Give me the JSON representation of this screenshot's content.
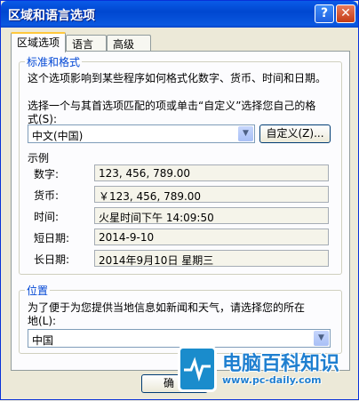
{
  "window": {
    "title": "区域和语言选项",
    "help_label": "?",
    "close_label": "✕"
  },
  "tabs": [
    {
      "label": "区域选项",
      "active": true
    },
    {
      "label": "语言",
      "active": false
    },
    {
      "label": "高级",
      "active": false
    }
  ],
  "standards": {
    "group_title": "标准和格式",
    "description": "这个选项影响到某些程序如何格式化数字、货币、时间和日期。",
    "select_prompt_line1": "选择一个与其首选项匹配的项或单击“自定义”选择您自己的格",
    "select_prompt_line2": "式(S):",
    "format_value": "中文(中国)",
    "customize_button": "自定义(Z)...",
    "samples_title": "示例",
    "samples": [
      {
        "label": "数字:",
        "value": "123, 456, 789.00"
      },
      {
        "label": "货币:",
        "value": "￥123, 456, 789.00"
      },
      {
        "label": "时间:",
        "value": "火星时间下午 14:09:50"
      },
      {
        "label": "短日期:",
        "value": "2014-9-10"
      },
      {
        "label": "长日期:",
        "value": "2014年9月10日 星期三"
      }
    ]
  },
  "location": {
    "group_title": "位置",
    "description_line1": "为了便于为您提供当地信息如新闻和天气，请选择您的所在",
    "description_line2": "地(L):",
    "value": "中国"
  },
  "footer": {
    "ok_button": "确"
  },
  "watermark": {
    "title": "电脑百科知识",
    "url": "www.pc-daily.com"
  }
}
